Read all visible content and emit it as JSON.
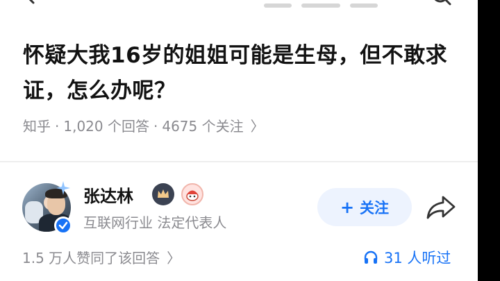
{
  "question": {
    "title": "怀疑大我16岁的姐姐可能是生母，但不敢求证，怎么办呢？",
    "source": "知乎",
    "separator": "·",
    "answers_count": "1,020 个回答",
    "followers_count": "4675 个关注",
    "more_chevron": "〉"
  },
  "answer": {
    "author_name": "张达林",
    "author_bio": "互联网行业 法定代表人",
    "follow_label": "关注",
    "follow_plus": "+",
    "votes_text": "1.5 万人赞同了该回答",
    "votes_chevron": "〉",
    "listeners_text": "31 人听过"
  },
  "colors": {
    "accent": "#1772f6",
    "meta_gray": "#8a8a8f",
    "title": "#121212"
  },
  "icons": [
    "back-arrow-icon",
    "search-icon",
    "verified-icon",
    "crown-badge-icon",
    "cute-badge-icon",
    "share-icon",
    "headphones-icon"
  ]
}
